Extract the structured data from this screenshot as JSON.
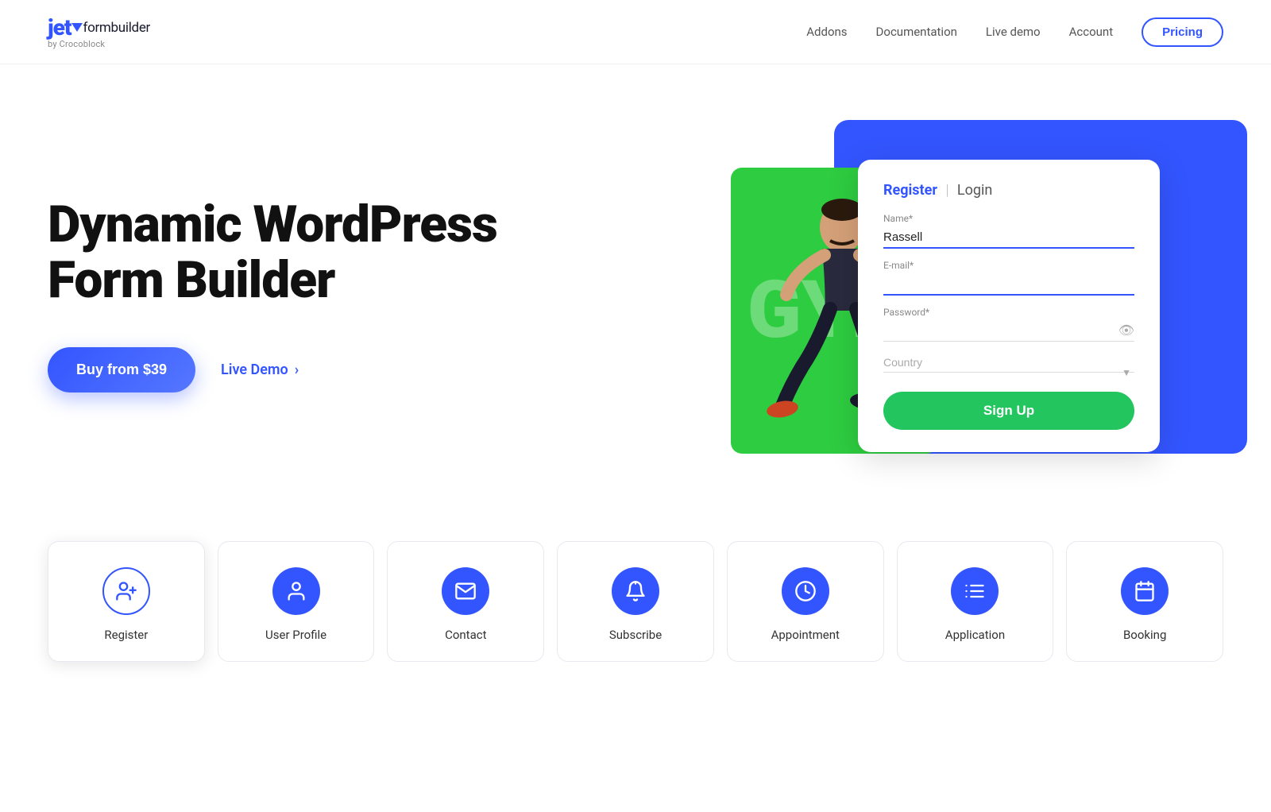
{
  "header": {
    "logo": {
      "jet": "jet",
      "formbuilder": "formbuilder",
      "sub": "by Crocoblock"
    },
    "nav": {
      "addons": "Addons",
      "documentation": "Documentation",
      "live_demo": "Live demo",
      "account": "Account",
      "pricing": "Pricing"
    }
  },
  "hero": {
    "title": "Dynamic WordPress Form Builder",
    "buy_btn": "Buy from $39",
    "live_demo": "Live Demo"
  },
  "form": {
    "header_register": "Register",
    "header_login": "Login",
    "name_label": "Name*",
    "name_value": "Rassell",
    "email_label": "E-mail*",
    "email_placeholder": "",
    "password_label": "Password*",
    "password_placeholder": "",
    "country_label": "Country",
    "country_placeholder": "Country",
    "signup_btn": "Sign Up"
  },
  "features": [
    {
      "icon": "user-plus",
      "label": "Register"
    },
    {
      "icon": "user",
      "label": "User Profile"
    },
    {
      "icon": "envelope",
      "label": "Contact"
    },
    {
      "icon": "bell",
      "label": "Subscribe"
    },
    {
      "icon": "clock",
      "label": "Appointment"
    },
    {
      "icon": "list",
      "label": "Application"
    },
    {
      "icon": "calendar",
      "label": "Booking"
    }
  ]
}
